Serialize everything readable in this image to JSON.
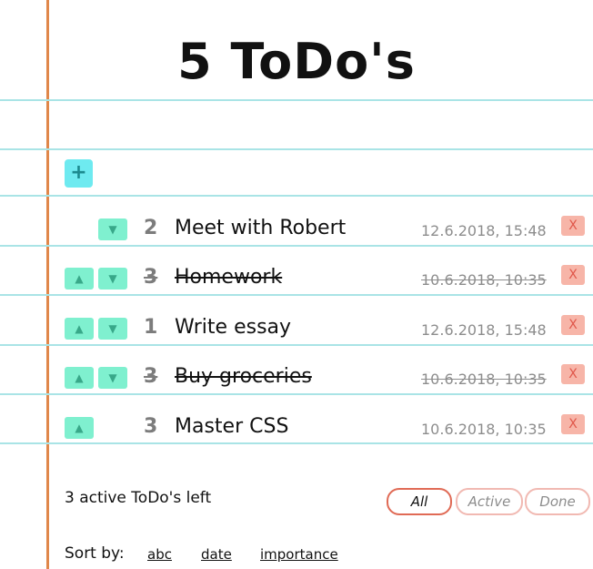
{
  "title": "5 ToDo's",
  "add_button": {
    "icon": "plus-icon",
    "label": "+"
  },
  "todos": [
    {
      "priority": "2",
      "text": "Meet with Robert",
      "date": "12.6.2018, 15:48",
      "done": false,
      "up": false,
      "down": true,
      "delete_label": "X"
    },
    {
      "priority": "3",
      "text": "Homework",
      "date": "10.6.2018, 10:35",
      "done": true,
      "up": true,
      "down": true,
      "delete_label": "X"
    },
    {
      "priority": "1",
      "text": "Write essay",
      "date": "12.6.2018, 15:48",
      "done": false,
      "up": true,
      "down": true,
      "delete_label": "X"
    },
    {
      "priority": "3",
      "text": "Buy groceries",
      "date": "10.6.2018, 10:35",
      "done": true,
      "up": true,
      "down": true,
      "delete_label": "X"
    },
    {
      "priority": "3",
      "text": "Master CSS",
      "date": "10.6.2018, 10:35",
      "done": false,
      "up": true,
      "down": false,
      "delete_label": "X"
    }
  ],
  "footer": {
    "left_count": "3 active ToDo's left",
    "filters": {
      "all": "All",
      "active": "Active",
      "done": "Done"
    },
    "sort_label": "Sort by:",
    "sort_options": {
      "abc": "abc",
      "date": "date",
      "importance": "importance"
    }
  },
  "colors": {
    "margin_line": "#e0874a",
    "rule_line": "#a9e4e6",
    "add_button": "#6eeaf0",
    "arrow_button": "#7ff0cf",
    "delete_button": "#f7b5a8",
    "filter_selected_border": "#e06a55",
    "filter_border": "#f1b9b2"
  }
}
